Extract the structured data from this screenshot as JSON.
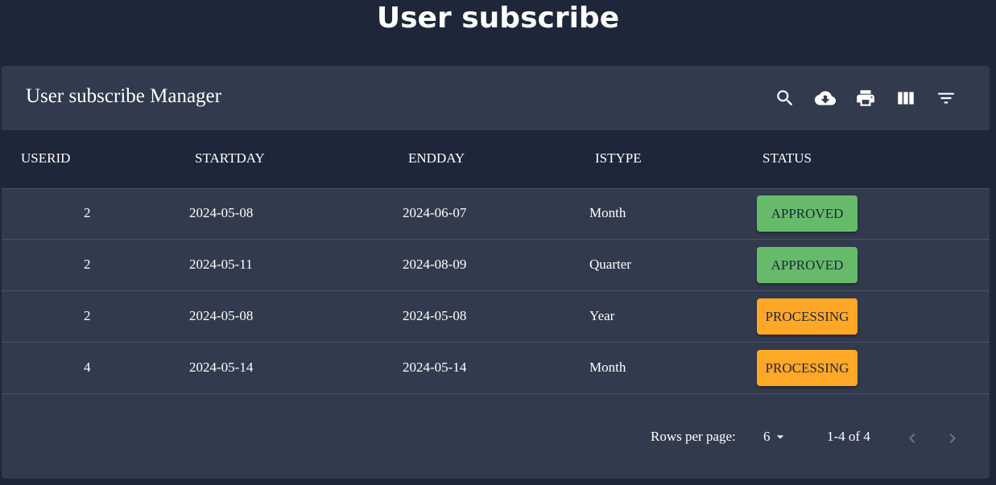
{
  "page": {
    "title": "User subscribe"
  },
  "toolbar": {
    "title": "User subscribe Manager",
    "icons": [
      "search-icon",
      "cloud-download-icon",
      "print-icon",
      "view-columns-icon",
      "filter-icon"
    ]
  },
  "table": {
    "columns": [
      "USERID",
      "STARTDAY",
      "ENDDAY",
      "ISTYPE",
      "STATUS"
    ],
    "rows": [
      {
        "userid": "2",
        "startday": "2024-05-08",
        "endday": "2024-06-07",
        "istype": "Month",
        "status": "APPROVED"
      },
      {
        "userid": "2",
        "startday": "2024-05-11",
        "endday": "2024-08-09",
        "istype": "Quarter",
        "status": "APPROVED"
      },
      {
        "userid": "2",
        "startday": "2024-05-08",
        "endday": "2024-05-08",
        "istype": "Year",
        "status": "PROCESSING"
      },
      {
        "userid": "4",
        "startday": "2024-05-14",
        "endday": "2024-05-14",
        "istype": "Month",
        "status": "PROCESSING"
      }
    ]
  },
  "pagination": {
    "rows_per_page_label": "Rows per page:",
    "rows_per_page": "6",
    "range": "1-4 of 4"
  },
  "colors": {
    "background": "#1e2739",
    "panel": "#323b4d",
    "approved": "#66bb6a",
    "processing": "#ffa726"
  }
}
